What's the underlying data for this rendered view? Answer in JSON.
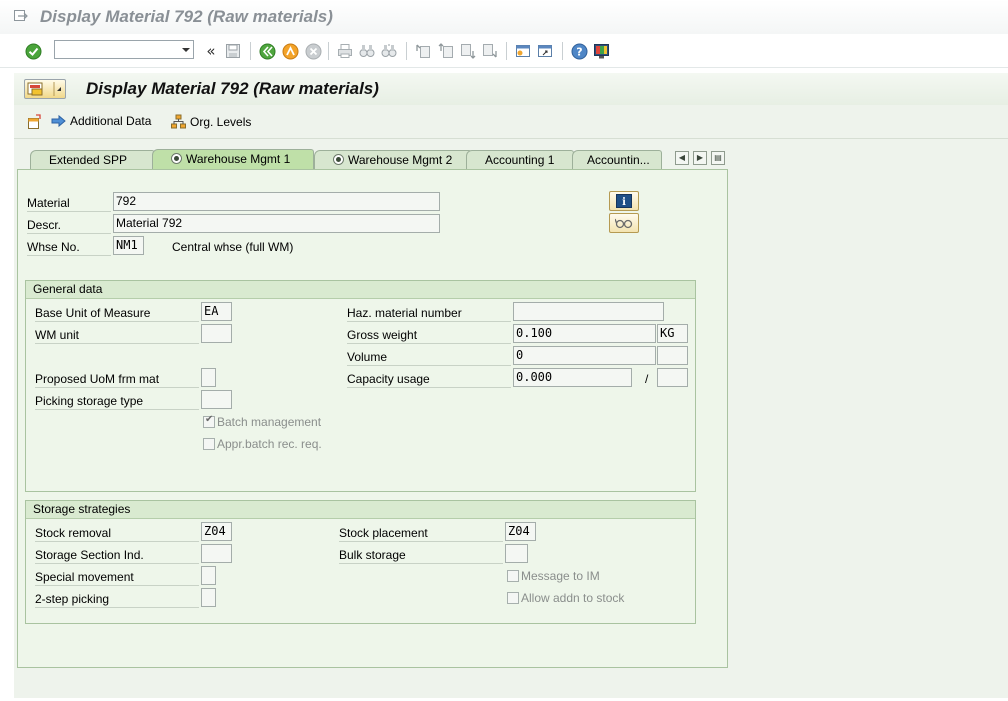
{
  "window": {
    "title": "Display Material 792 (Raw materials)"
  },
  "toolbar": {
    "command_field_value": "",
    "icons": [
      "enter-check-icon",
      "command-dropdown-icon",
      "expand-icon",
      "save-icon",
      "back-icon",
      "exit-icon",
      "cancel-icon",
      "print-icon",
      "find-icon",
      "find-next-icon",
      "first-page-icon",
      "previous-page-icon",
      "next-page-icon",
      "last-page-icon",
      "create-session-icon",
      "shortcut-icon",
      "help-icon",
      "customize-layout-icon"
    ]
  },
  "app": {
    "title": "Display Material 792 (Raw materials)",
    "toolbar": {
      "additional_data": "Additional Data",
      "org_levels": "Org. Levels"
    }
  },
  "tabs": [
    {
      "label": "Extended SPP",
      "active": false,
      "radio": false
    },
    {
      "label": "Warehouse Mgmt 1",
      "active": true,
      "radio": true
    },
    {
      "label": "Warehouse Mgmt 2",
      "active": false,
      "radio": true
    },
    {
      "label": "Accounting 1",
      "active": false,
      "radio": false
    },
    {
      "label": "Accountin...",
      "active": false,
      "radio": false
    }
  ],
  "header_fields": {
    "material_label": "Material",
    "material_value": "792",
    "descr_label": "Descr.",
    "descr_value": "Material 792",
    "whse_label": "Whse No.",
    "whse_value": "NM1",
    "whse_text": "Central whse (full WM)"
  },
  "general_data": {
    "title": "General data",
    "base_uom_label": "Base Unit of Measure",
    "base_uom_value": "EA",
    "wm_unit_label": "WM unit",
    "wm_unit_value": "",
    "proposed_uom_label": "Proposed UoM frm mat",
    "picking_storage_label": "Picking storage type",
    "picking_storage_value": "",
    "batch_mgmt_label": "Batch management",
    "batch_mgmt_checked": true,
    "appr_batch_label": "Appr.batch rec. req.",
    "appr_batch_checked": false,
    "haz_label": "Haz. material number",
    "haz_value": "",
    "gross_weight_label": "Gross weight",
    "gross_weight_value": "0.100",
    "gross_weight_unit": "KG",
    "volume_label": "Volume",
    "volume_value": "0",
    "volume_unit": "",
    "capacity_label": "Capacity usage",
    "capacity_value": "0.000",
    "capacity_sep": "/",
    "capacity_unit": ""
  },
  "storage_strategies": {
    "title": "Storage strategies",
    "stock_removal_label": "Stock removal",
    "stock_removal_value": "Z04",
    "storage_section_label": "Storage Section Ind.",
    "storage_section_value": "",
    "special_movement_label": "Special movement",
    "two_step_label": "2-step picking",
    "stock_placement_label": "Stock placement",
    "stock_placement_value": "Z04",
    "bulk_storage_label": "Bulk storage",
    "bulk_storage_value": "",
    "message_im_label": "Message to IM",
    "message_im_checked": false,
    "allow_addn_label": "Allow addn to stock",
    "allow_addn_checked": false
  }
}
